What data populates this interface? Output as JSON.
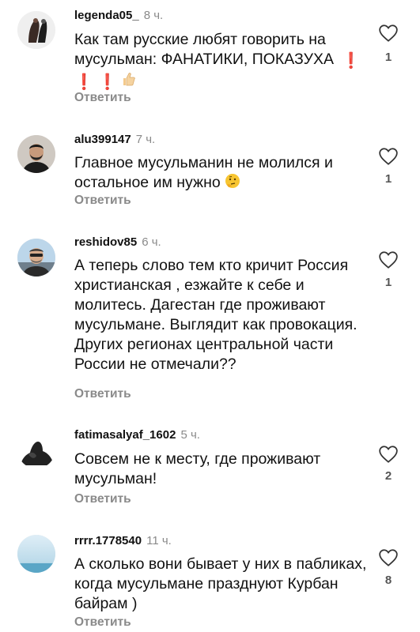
{
  "comments": [
    {
      "username": "legenda05_",
      "time": "8 ч.",
      "text": "Как там русские любят говорить на мусульман: ФАНАТИКИ, ПОКАЗУХА",
      "emojis": [
        "red-exclamation",
        "red-exclamation",
        "red-exclamation",
        "thumbs-up"
      ],
      "reply_label": "Ответить",
      "likes": "1"
    },
    {
      "username": "alu399147",
      "time": "7 ч.",
      "text": "Главное мусульманин не молился и остальное им нужно",
      "emojis": [
        "thinking-face"
      ],
      "reply_label": "Ответить",
      "likes": "1"
    },
    {
      "username": "reshidov85",
      "time": "6 ч.",
      "text": "А теперь слово тем кто кричит Россия христианская , езжайте к себе и молитесь. Дагестан где проживают мусульмане. Выглядит как провокация. Других регионах центральной части России не отмечали??",
      "reply_label": "Ответить",
      "likes": "1"
    },
    {
      "username": "fatimasalyaf_1602",
      "time": "5 ч.",
      "text": "Совсем не к месту, где проживают мусульман!",
      "reply_label": "Ответить",
      "likes": "2"
    },
    {
      "username": "rrrr.1778540",
      "time": "11 ч.",
      "text": "А сколько вони бывает у них в пабликах, когда мусульмане празднуют Курбан байрам )",
      "reply_label": "Ответить",
      "likes": "8"
    }
  ],
  "colors": {
    "text": "#111111",
    "muted": "#8a8a8a",
    "background": "#ffffff"
  }
}
